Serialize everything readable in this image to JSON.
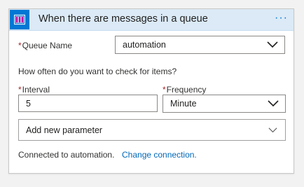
{
  "header": {
    "title": "When there are messages in a queue",
    "more_label": "···",
    "icon": "storage-queue-icon",
    "accent": "#0078d4"
  },
  "queue_name": {
    "label": "Queue Name",
    "required_mark": "*",
    "value": "automation"
  },
  "check_prompt": "How often do you want to check for items?",
  "interval": {
    "label": "Interval",
    "required_mark": "*",
    "value": "5"
  },
  "frequency": {
    "label": "Frequency",
    "required_mark": "*",
    "value": "Minute"
  },
  "add_parameter": {
    "label": "Add new parameter"
  },
  "connection": {
    "text": "Connected to automation.",
    "link": "Change connection."
  }
}
